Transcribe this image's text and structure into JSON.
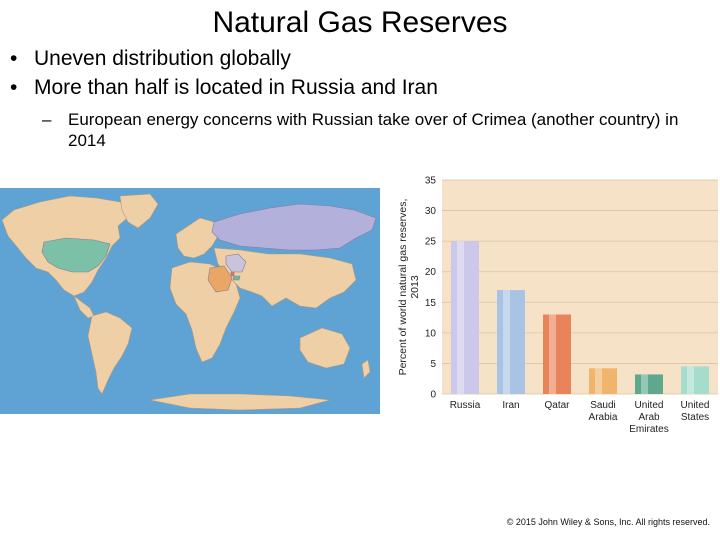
{
  "slide": {
    "title": "Natural Gas Reserves",
    "bullets": [
      "Uneven distribution globally",
      "More than half is located in Russia and Iran"
    ],
    "sub_bullet": "European energy concerns with Russian take over of Crimea (another country) in 2014",
    "bullet_glyph": "•",
    "dash_glyph": "–",
    "footer": "© 2015 John Wiley & Sons, Inc. All rights reserved."
  },
  "map": {
    "ocean_color": "#5ea3d4",
    "land_color": "#efcfa6",
    "highlight_colors": {
      "Russia": "#b3b1dc",
      "United States": "#7cc0a7",
      "Iran": "#c9c3dc",
      "Qatar": "#e2744b",
      "Saudi Arabia": "#e9a664",
      "United Arab Emirates": "#6fb79f"
    }
  },
  "chart_data": {
    "type": "bar",
    "categories": [
      [
        "Russia"
      ],
      [
        "Iran"
      ],
      [
        "Qatar"
      ],
      [
        "Saudi",
        "Arabia"
      ],
      [
        "United",
        "Arab",
        "Emirates"
      ],
      [
        "United",
        "States"
      ]
    ],
    "values": [
      25,
      17,
      13,
      4.2,
      3.2,
      4.5
    ],
    "colors": [
      "#cbc8ea",
      "#a9c3e4",
      "#e8835a",
      "#f0b46c",
      "#5ea88d",
      "#a6dccc"
    ],
    "ylabel": [
      "Percent of world natural gas reserves,",
      "2013"
    ],
    "ylim": [
      0,
      35
    ],
    "yticks": [
      0,
      5,
      10,
      15,
      20,
      25,
      30,
      35
    ],
    "grid": true,
    "plot_background": "#f6e3c7"
  }
}
